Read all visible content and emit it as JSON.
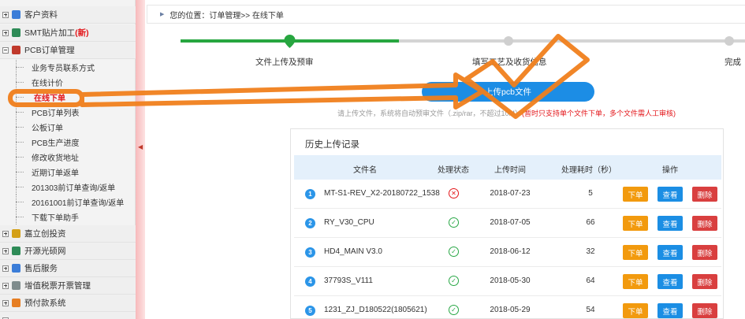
{
  "sidebar": {
    "groups_top": [
      {
        "label": "客户资料",
        "icon": "user-icon",
        "color": "#3b7dd8"
      },
      {
        "label": "SMT贴片加工",
        "badge": "(新)",
        "icon": "grid-icon",
        "color": "#2e8b57"
      },
      {
        "label": "PCB订单管理",
        "icon": "board-icon",
        "color": "#c0392b"
      }
    ],
    "items": [
      {
        "label": "业务专员联系方式"
      },
      {
        "label": "在线计价"
      },
      {
        "label": "在线下单",
        "active": true
      },
      {
        "label": "PCB订单列表"
      },
      {
        "label": "公板订单"
      },
      {
        "label": "PCB生产进度"
      },
      {
        "label": "修改收货地址"
      },
      {
        "label": "近期订单返单"
      },
      {
        "label": "201303前订单查询/返单"
      },
      {
        "label": "20161001前订单查询/返单"
      },
      {
        "label": "下载下单助手"
      }
    ],
    "groups_bottom": [
      {
        "label": "嘉立创投资",
        "icon": "chart-icon",
        "color": "#d4a017"
      },
      {
        "label": "开源光硕网",
        "icon": "grid-icon",
        "color": "#2e8b57"
      },
      {
        "label": "售后服务",
        "icon": "user-icon",
        "color": "#3b7dd8"
      },
      {
        "label": "增值税票开票管理",
        "icon": "document-icon",
        "color": "#7f8c8d"
      },
      {
        "label": "预付款系统",
        "icon": "wallet-icon",
        "color": "#e67e22"
      }
    ]
  },
  "breadcrumb": {
    "text": "您的位置：订单管理>> 在线下单"
  },
  "steps": [
    {
      "label": "文件上传及预审",
      "state": "current"
    },
    {
      "label": "填写工艺及收货信息",
      "state": "pending"
    },
    {
      "label": "完成",
      "state": "pending"
    }
  ],
  "upload": {
    "button_label": "上传pcb文件",
    "hint": "请上传文件，系统将自动预审文件（.zip/rar，不超过10M）",
    "warning": "(暂时只支持单个文件下单，多个文件需人工审核)"
  },
  "history": {
    "title": "历史上传记录",
    "columns": [
      "文件名",
      "处理状态",
      "上传时间",
      "处理耗时（秒）",
      "操作"
    ],
    "rows": [
      {
        "num": "1",
        "file": "MT-S1-REV_X2-20180722_1538",
        "status": "fail",
        "date": "2018-07-23",
        "duration": "5"
      },
      {
        "num": "2",
        "file": "RY_V30_CPU",
        "status": "ok",
        "date": "2018-07-05",
        "duration": "66"
      },
      {
        "num": "3",
        "file": "HD4_MAIN V3.0",
        "status": "ok",
        "date": "2018-06-12",
        "duration": "32"
      },
      {
        "num": "4",
        "file": "37793S_V111",
        "status": "ok",
        "date": "2018-05-30",
        "duration": "64"
      },
      {
        "num": "5",
        "file": "1231_ZJ_D180522(1805621)",
        "status": "ok",
        "date": "2018-05-29",
        "duration": "54"
      }
    ],
    "actions": {
      "order": "下单",
      "view": "查看",
      "delete": "删除"
    }
  },
  "colors": {
    "progress_done": "#27a640",
    "accent_blue": "#1c8de5",
    "order_orange": "#f29a0e",
    "delete_red": "#d93f3f",
    "annotation_orange": "#f07f1c"
  }
}
